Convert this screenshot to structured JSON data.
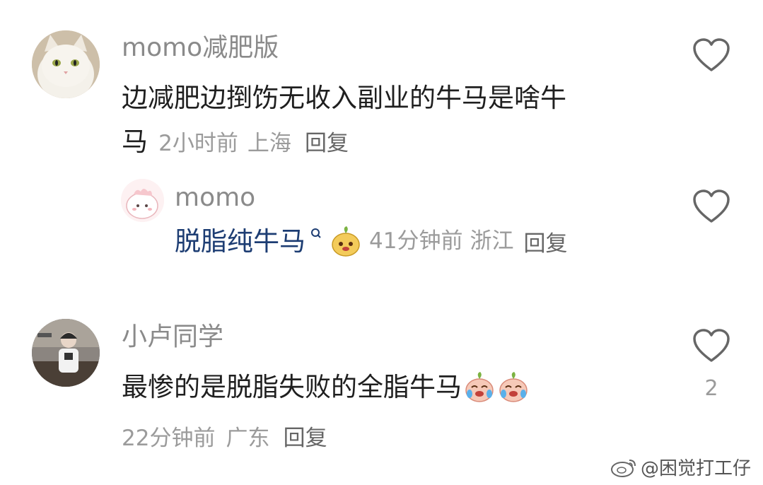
{
  "comments": [
    {
      "username": "momo减肥版",
      "text_line1": "边减肥边捯饬无收入副业的牛马是啥牛",
      "text_line2": "马",
      "time": "2小时前",
      "location": "上海",
      "reply_label": "回复",
      "avatar": "cat-avatar",
      "reply": {
        "username": "momo",
        "text": "脱脂纯牛马",
        "emoji": "peach-emoji",
        "time": "41分钟前",
        "location": "浙江",
        "reply_label": "回复",
        "avatar": "cartoon-avatar"
      }
    },
    {
      "username": "小卢同学",
      "text": "最惨的是脱脂失败的全脂牛马",
      "emojis": [
        "crying-peach-emoji",
        "crying-peach-emoji"
      ],
      "time": "22分钟前",
      "location": "广东",
      "reply_label": "回复",
      "likes": "2",
      "avatar": "photo-avatar"
    }
  ],
  "watermark": "@困觉打工仔",
  "colors": {
    "username": "#8a8a8a",
    "reply_text": "#1d3d73",
    "meta": "#9b9b9b"
  }
}
